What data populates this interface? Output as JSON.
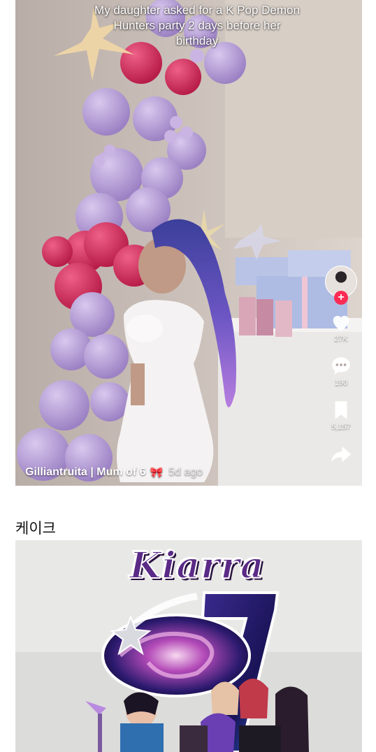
{
  "post": {
    "caption": "My daughter asked for a K Pop Demon Hunters party 2 days before her birthday",
    "author": "Gilliantruita | Mum of 6",
    "author_emoji": "🎀",
    "time_ago": "5d ago",
    "sidebar": {
      "follow_symbol": "+",
      "likes": "27K",
      "comments": "190",
      "saves": "5,157"
    }
  },
  "section": {
    "title": "케이크"
  },
  "cake_topper": {
    "name": "Kiarra",
    "age": "7"
  },
  "colors": {
    "balloon_lilac": "#b9a0d6",
    "balloon_pink": "#d8325f",
    "follow_red": "#fe2c55",
    "topper_purple": "#5a2a86"
  }
}
